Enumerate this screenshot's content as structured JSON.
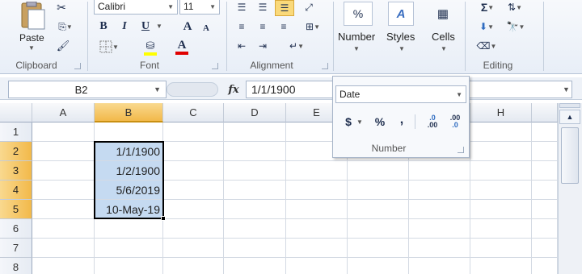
{
  "ribbon": {
    "clipboard": {
      "paste_label": "Paste",
      "group_label": "Clipboard"
    },
    "font": {
      "font_name": "Calibri",
      "font_size": "11",
      "bold": "B",
      "italic": "I",
      "underline": "U",
      "grow": "A",
      "shrink": "A",
      "font_color": "A",
      "group_label": "Font"
    },
    "alignment": {
      "group_label": "Alignment"
    },
    "number": {
      "percent": "%",
      "label": "Number"
    },
    "styles": {
      "label": "Styles"
    },
    "cells": {
      "label": "Cells"
    },
    "editing": {
      "sigma": "Σ",
      "group_label": "Editing"
    }
  },
  "formula_bar": {
    "name_box": "B2",
    "fx": "fx",
    "value": "1/1/1900"
  },
  "grid": {
    "columns": [
      "A",
      "B",
      "C",
      "D",
      "E",
      "F",
      "G",
      "H"
    ],
    "rows": [
      "1",
      "2",
      "3",
      "4",
      "5",
      "6",
      "7",
      "8"
    ],
    "b_values": [
      "",
      "1/1/1900",
      "1/2/1900",
      "5/6/2019",
      "10-May-19",
      "",
      "",
      ""
    ]
  },
  "number_panel": {
    "format": "Date",
    "currency": "$",
    "percent": "%",
    "comma": ",",
    "inc_decimal": ".00",
    "dec_decimal": ".0",
    "group_label": "Number"
  },
  "colors": {
    "selection_fill": "#c5daf1",
    "header_selected": "#f2b94a"
  }
}
